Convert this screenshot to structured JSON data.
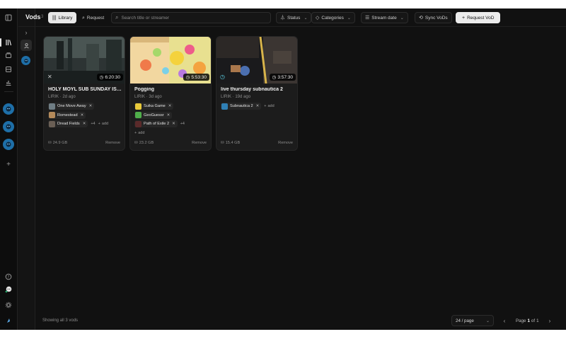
{
  "header": {
    "title": "Vods",
    "title_count": "3",
    "tabs": [
      {
        "label": "Library",
        "icon": "library-icon",
        "active": true
      },
      {
        "label": "Request",
        "icon": "search-icon",
        "active": false
      }
    ],
    "search": {
      "placeholder": "Search title or streamer",
      "value": ""
    },
    "filters": {
      "status": "Status",
      "categories": "Categories",
      "sort": "Stream date"
    },
    "sync_button": "Sync VoDs",
    "request_button": "Request VoD"
  },
  "sidebar": {
    "icons": [
      "sidebar-toggle-icon",
      "library-icon",
      "film-icon",
      "calendar-icon",
      "chart-icon"
    ],
    "bottom_icons": [
      "help-icon",
      "chat-icon",
      "settings-icon",
      "theme-icon"
    ],
    "add_label": "+"
  },
  "vods": [
    {
      "title": "HOLY MOYL SUB SUNDAY IS ...",
      "meta": "LIRIK · 2d ago",
      "duration": "6:20:30",
      "size": "24.9 GB",
      "remove": "Remove",
      "tags": [
        "One Move Away",
        "Romestead",
        "Dread Fields"
      ],
      "more": "+4",
      "add": "add"
    },
    {
      "title": "Pogging",
      "meta": "LIRIK · 3d ago",
      "duration": "5:53:30",
      "size": "23.2 GB",
      "remove": "Remove",
      "tags": [
        "Suika Game",
        "GeoGuessr",
        "Path of Exile 2"
      ],
      "more": "+4",
      "add": "add"
    },
    {
      "title": "live thursday subnautica 2",
      "meta": "LIRIK · 19d ago",
      "duration": "3:57:30",
      "size": "15.4 GB",
      "remove": "Remove",
      "tags": [
        "Subnautica 2"
      ],
      "more": "",
      "add": "add"
    }
  ],
  "footer": {
    "showing": "Showing all 3 vods",
    "per_page": "24 / page",
    "page_prefix": "Page",
    "page": "1",
    "page_of": "of",
    "total_pages": "1"
  },
  "colors": {
    "accent": "#1e6fa8",
    "background": "#111111",
    "card": "#1c1c1c"
  }
}
